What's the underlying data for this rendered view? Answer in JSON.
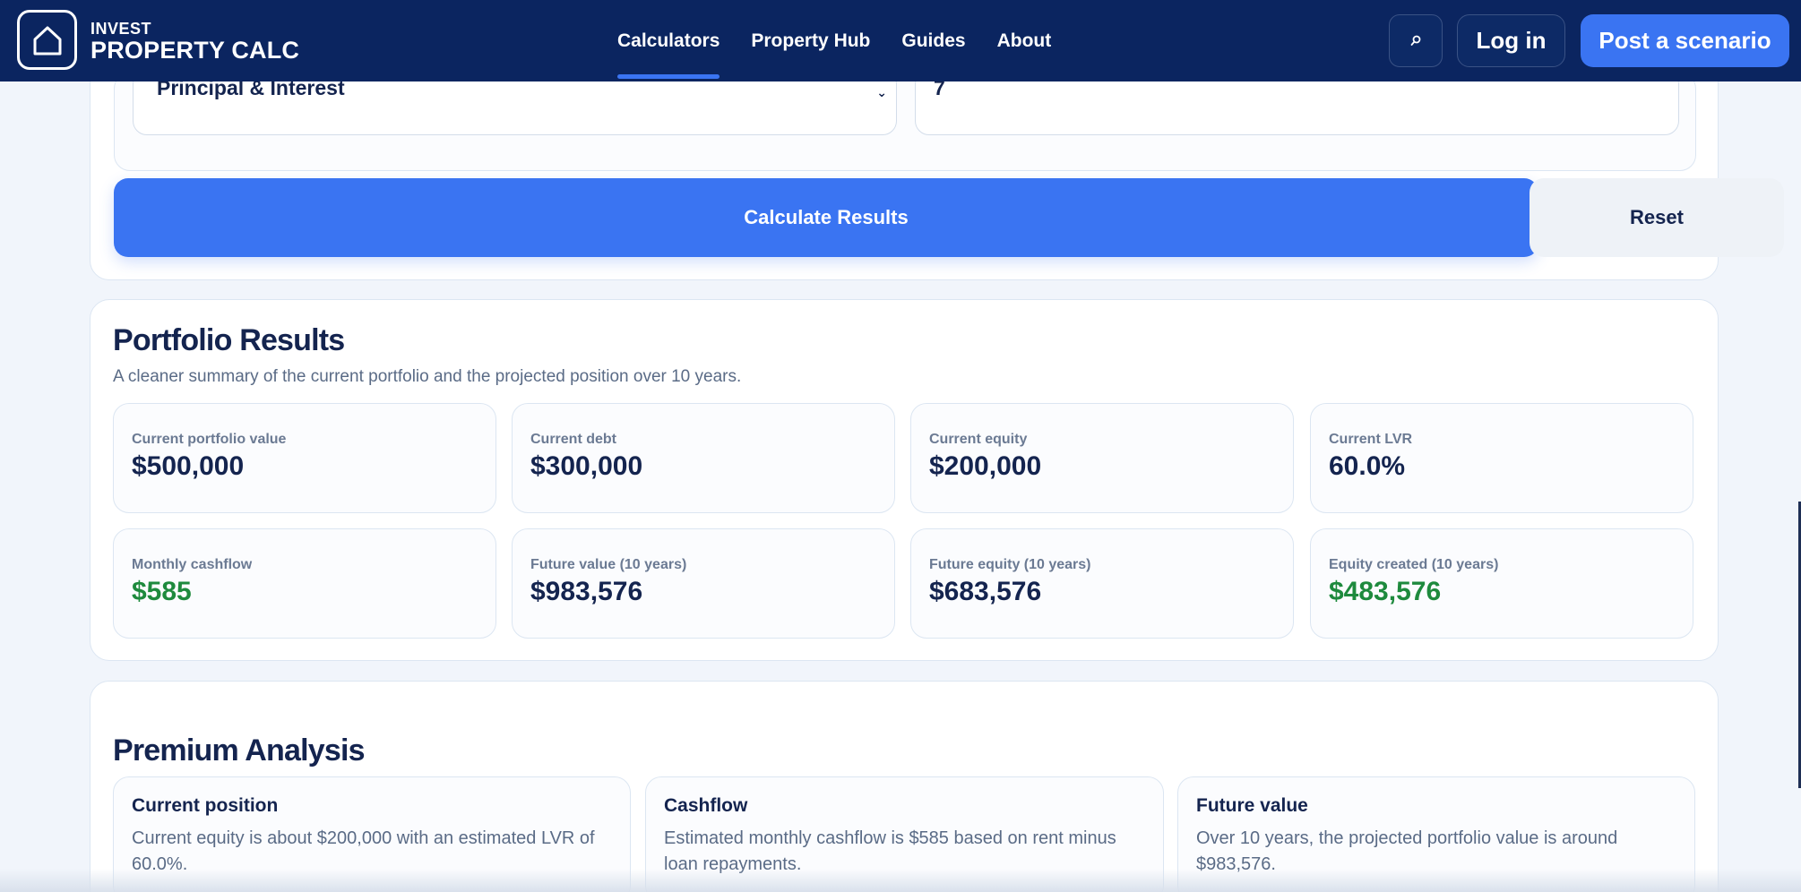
{
  "header": {
    "logo_small": "INVEST",
    "logo_big": "PROPERTY CALC",
    "nav": [
      {
        "label": "Calculators",
        "active": true
      },
      {
        "label": "Property Hub"
      },
      {
        "label": "Guides"
      },
      {
        "label": "About"
      }
    ],
    "login_label": "Log in",
    "post_label": "Post a scenario",
    "brand_color": "#0b2560",
    "accent_color": "#3a74f2"
  },
  "form": {
    "repayment_type": "Principal & Interest",
    "second_field_value": "7",
    "calculate_label": "Calculate Results",
    "reset_label": "Reset"
  },
  "results": {
    "title": "Portfolio Results",
    "subtitle": "A cleaner summary of the current portfolio and the projected position over 10 years.",
    "stats": [
      {
        "label": "Current portfolio value",
        "value": "$500,000"
      },
      {
        "label": "Current debt",
        "value": "$300,000"
      },
      {
        "label": "Current equity",
        "value": "$200,000"
      },
      {
        "label": "Current LVR",
        "value": "60.0%"
      },
      {
        "label": "Monthly cashflow",
        "value": "$585"
      },
      {
        "label": "Future value (10 years)",
        "value": "$983,576"
      },
      {
        "label": "Future equity (10 years)",
        "value": "$683,576"
      },
      {
        "label": "Equity created (10 years)",
        "value": "$483,576"
      }
    ],
    "positive_color": "#1e8a3d"
  },
  "premium": {
    "title": "Premium Analysis",
    "cards": [
      {
        "title": "Current position",
        "text": "Current equity is about $200,000 with an estimated LVR of 60.0%."
      },
      {
        "title": "Cashflow",
        "text": "Estimated monthly cashflow is $585 based on rent minus loan repayments."
      },
      {
        "title": "Future value",
        "text": "Over 10 years, the projected portfolio value is around $983,576."
      }
    ]
  }
}
